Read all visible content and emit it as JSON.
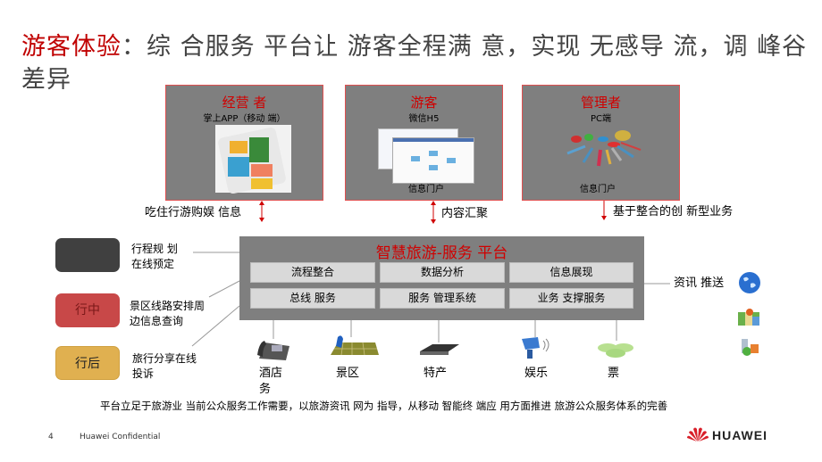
{
  "title": {
    "highlight": "游客体验",
    "rest": "：综 合服务 平台让 游客全程满 意，实现 无感导 流，调 峰谷差异"
  },
  "cards": [
    {
      "title": "经营 者",
      "subtitle": "掌上APP（移动 端）",
      "image": "mobile-app-screenshot"
    },
    {
      "title": "游客",
      "subtitle": "微信H5",
      "image": "web-workflow-screenshot",
      "portal": "信息门户"
    },
    {
      "title": "管理者",
      "subtitle": "PC端",
      "image": "dashboard-graphic",
      "portal": "信息门户"
    }
  ],
  "arrow_labels": [
    "吃住行游购娱 信息",
    "内容汇聚",
    "基于整合的创 新型业务"
  ],
  "platform": {
    "title": "智慧旅游-服务 平台",
    "cells": [
      "流程整合",
      "数据分析",
      "信息展现",
      "总线 服务",
      "服务 管理系统",
      "业务 支撑服务"
    ]
  },
  "stages": [
    {
      "label": "",
      "desc": "行程规 划在线预定",
      "color": "#404040"
    },
    {
      "label": "行中",
      "desc": "景区线路安排周边信息查询",
      "color": "#c84848"
    },
    {
      "label": "行后",
      "desc": "旅行分享在线投诉",
      "color": "#e0b050"
    }
  ],
  "push": {
    "label": "资讯 推送",
    "icons": [
      "globe-icon",
      "map-icon",
      "lab-icon"
    ]
  },
  "nodes": [
    {
      "label": "酒店务",
      "icon": "phone-icon"
    },
    {
      "label": "景区",
      "icon": "grid-map-icon"
    },
    {
      "label": "特产",
      "icon": "router-icon"
    },
    {
      "label": "娱乐",
      "icon": "camera-icon"
    },
    {
      "label": "票",
      "icon": "database-icon"
    }
  ],
  "summary": "平台立足于旅游业 当前公众服务工作需要，以旅游资讯 网为 指导，从移动 智能终 端应 用方面推进 旅游公众服务体系的完善",
  "footer": {
    "page": "4",
    "confidential": "Huawei Confidential",
    "brand": "HUAWEI"
  },
  "colors": {
    "accent": "#c00000",
    "card": "#7f7f7f",
    "cell": "#d9d9d9"
  }
}
